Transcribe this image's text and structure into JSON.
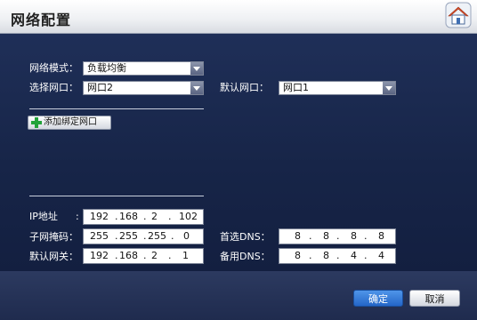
{
  "window": {
    "title": "网络配置",
    "home_icon": "home-icon"
  },
  "mode": {
    "label": "网络模式：",
    "value": "负载均衡"
  },
  "select_port": {
    "label": "选择网口：",
    "value": "网口2"
  },
  "default_port": {
    "label": "默认网口：",
    "value": "网口1"
  },
  "add_binding": {
    "label": "添加绑定网口",
    "icon": "plus-icon"
  },
  "ip": {
    "label": "IP地址",
    "colon": ":",
    "octets": [
      "192",
      "168",
      "2",
      "102"
    ]
  },
  "mask": {
    "label": "子网掩码：",
    "octets": [
      "255",
      "255",
      "255",
      "0"
    ]
  },
  "gateway": {
    "label": "默认网关：",
    "octets": [
      "192",
      "168",
      "2",
      "1"
    ]
  },
  "dns1": {
    "label": "首选DNS：",
    "octets": [
      "8",
      "8",
      "8",
      "8"
    ]
  },
  "dns2": {
    "label": "备用DNS：",
    "octets": [
      "8",
      "8",
      "4",
      "4"
    ]
  },
  "buttons": {
    "ok": "确定",
    "cancel": "取消"
  },
  "colors": {
    "background": "#142044",
    "primary_button": "#2f74d6",
    "plus": "#23a33a"
  }
}
